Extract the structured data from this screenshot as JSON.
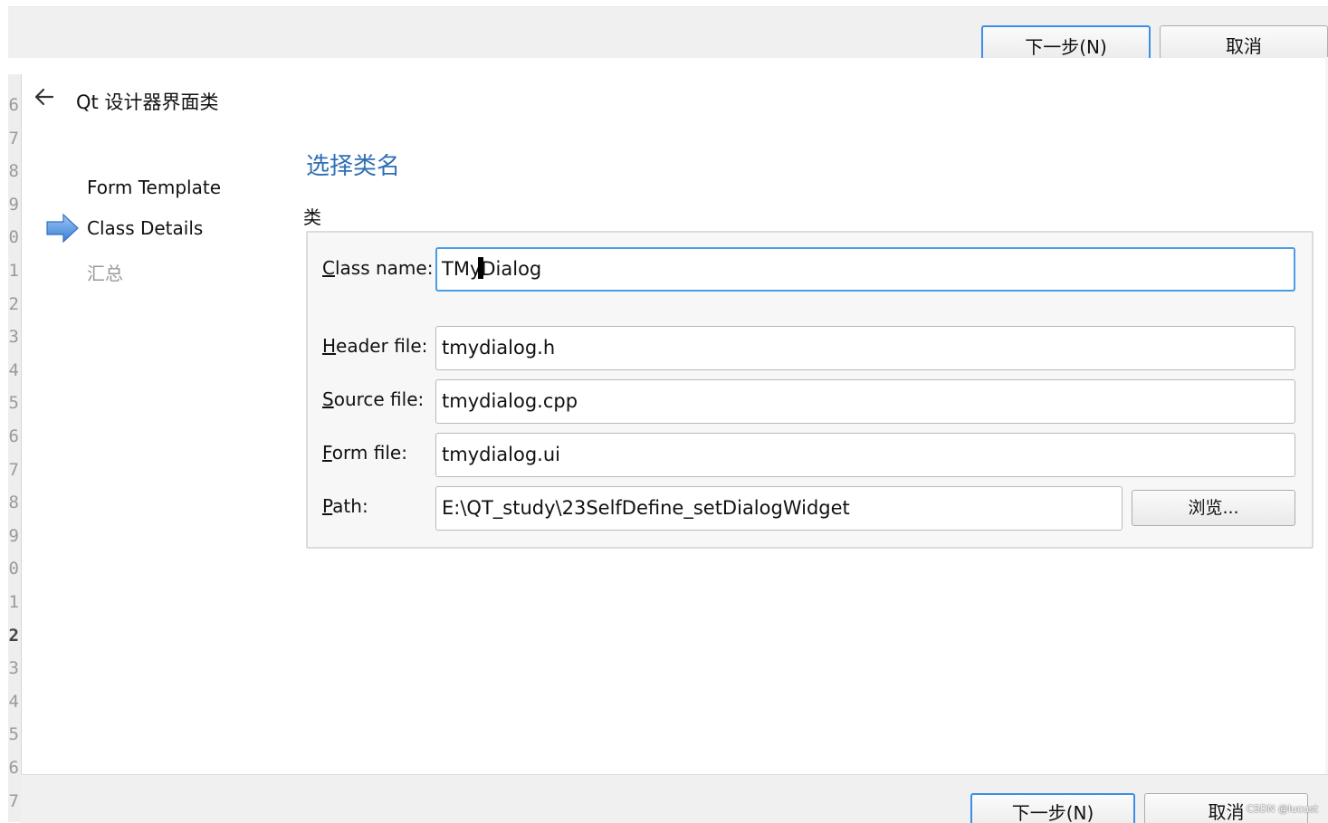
{
  "top_buttons": {
    "next": "下一步(N)",
    "next_mnemonic": "N",
    "cancel": "取消"
  },
  "gutter_numbers": [
    "6",
    "7",
    "8",
    "9",
    "0",
    "1",
    "2",
    "3",
    "4",
    "5",
    "6",
    "7",
    "8",
    "9",
    "0",
    "1",
    "2",
    "3",
    "4",
    "5",
    "6",
    "7"
  ],
  "wizard": {
    "title": "Qt 设计器界面类"
  },
  "steps": [
    {
      "label": "Form Template",
      "state": "done"
    },
    {
      "label": "Class Details",
      "state": "current"
    },
    {
      "label": "汇总",
      "state": "pending"
    }
  ],
  "page": {
    "title": "选择类名",
    "group_label": "类"
  },
  "form": {
    "class_name": {
      "label": "Class name:",
      "mnemonic": "C",
      "value_before_caret": "TMy",
      "value_after_caret": "Dialog"
    },
    "header_file": {
      "label": "Header file:",
      "mnemonic": "H",
      "value": "tmydialog.h"
    },
    "source_file": {
      "label": "Source file:",
      "mnemonic": "S",
      "value": "tmydialog.cpp"
    },
    "form_file": {
      "label": "Form file:",
      "mnemonic": "F",
      "value": "tmydialog.ui"
    },
    "path": {
      "label": "Path:",
      "mnemonic": "P",
      "value": "E:\\QT_study\\23SelfDefine_setDialogWidget",
      "browse_label": "浏览..."
    }
  },
  "bottom_buttons": {
    "next": "下一步(N)",
    "cancel": "取消"
  },
  "watermark": "CSDN @lucust",
  "colors": {
    "accent_blue": "#3c8ee6",
    "title_blue": "#2f6fb5",
    "dim_text": "#9a9a9a"
  }
}
